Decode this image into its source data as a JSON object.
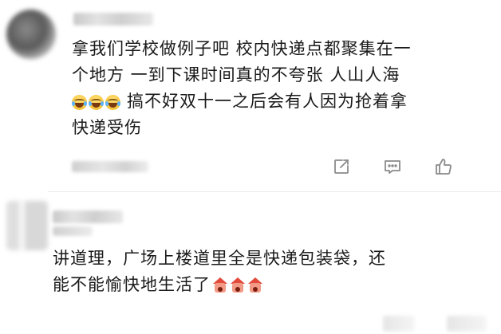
{
  "comments": [
    {
      "lines": [
        "拿我们学校做例子吧 校内快递点都聚集在一",
        "个地方 一到下课时间真的不夸张 人山人海",
        "搞不好双十一之后会有人因为抢着拿",
        "快递受伤"
      ],
      "emoji": "laugh-cry",
      "actions": [
        "share",
        "comment",
        "like"
      ]
    },
    {
      "lines": [
        "讲道理，广场上楼道里全是快递包装袋，还",
        "能不能愉快地生活了"
      ],
      "emoji": "scream-house"
    }
  ],
  "colors": {
    "text": "#1a1a1a",
    "icon": "#8a8a8a",
    "divider": "#ececec"
  }
}
